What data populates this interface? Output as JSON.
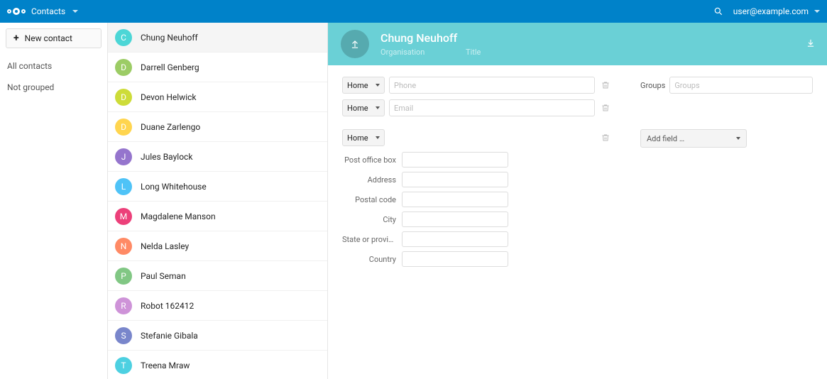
{
  "topbar": {
    "app_name": "Contacts",
    "user": "user@example.com"
  },
  "sidebar": {
    "new_contact_label": "New contact",
    "links": [
      "All contacts",
      "Not grouped"
    ]
  },
  "contacts": [
    {
      "initial": "C",
      "color": "#4cd6d6",
      "name": "Chung Neuhoff",
      "active": true
    },
    {
      "initial": "D",
      "color": "#9ccc65",
      "name": "Darrell Genberg"
    },
    {
      "initial": "D",
      "color": "#cddc39",
      "name": "Devon Helwick"
    },
    {
      "initial": "D",
      "color": "#ffd54f",
      "name": "Duane Zarlengo"
    },
    {
      "initial": "J",
      "color": "#9575cd",
      "name": "Jules Baylock"
    },
    {
      "initial": "L",
      "color": "#4fc3f7",
      "name": "Long Whitehouse"
    },
    {
      "initial": "M",
      "color": "#ec407a",
      "name": "Magdalene Manson"
    },
    {
      "initial": "N",
      "color": "#ff8a65",
      "name": "Nelda Lasley"
    },
    {
      "initial": "P",
      "color": "#81c784",
      "name": "Paul Seman"
    },
    {
      "initial": "R",
      "color": "#ce93d8",
      "name": "Robot 162412"
    },
    {
      "initial": "S",
      "color": "#7986cb",
      "name": "Stefanie Gibala"
    },
    {
      "initial": "T",
      "color": "#4dd0e1",
      "name": "Treena Mraw"
    }
  ],
  "detail": {
    "name": "Chung Neuhoff",
    "org_placeholder": "Organisation",
    "title_placeholder": "Title",
    "phone": {
      "type": "Home",
      "placeholder": "Phone",
      "value": ""
    },
    "email": {
      "type": "Home",
      "placeholder": "Email",
      "value": ""
    },
    "address": {
      "type": "Home",
      "fields": [
        {
          "label": "Post office box",
          "value": ""
        },
        {
          "label": "Address",
          "value": ""
        },
        {
          "label": "Postal code",
          "value": ""
        },
        {
          "label": "City",
          "value": ""
        },
        {
          "label": "State or provin…",
          "value": ""
        },
        {
          "label": "Country",
          "value": ""
        }
      ]
    },
    "groups": {
      "label": "Groups",
      "placeholder": "Groups",
      "value": ""
    },
    "add_field_label": "Add field …"
  }
}
